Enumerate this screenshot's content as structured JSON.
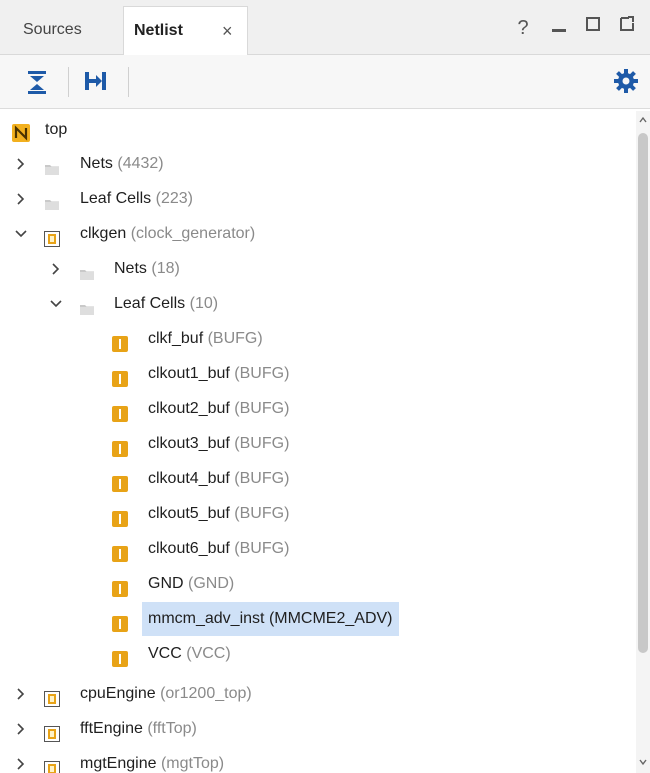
{
  "tabs": [
    {
      "label": "Sources"
    },
    {
      "label": "Netlist",
      "close": "×"
    }
  ],
  "window_controls": {
    "help": "?",
    "minimize": "_",
    "maximize": "☐",
    "float": "⧉"
  },
  "toolbar": {
    "collapse_all_icon": "collapse-all-icon",
    "expand_all_icon": "expand-all-icon",
    "settings_icon": "gear-icon"
  },
  "tree": {
    "root": {
      "name": "top",
      "icon": "N"
    },
    "rows": [
      {
        "name": "Nets",
        "meta": "(4432)"
      },
      {
        "name": "Leaf Cells",
        "meta": "(223)"
      },
      {
        "name": "clkgen",
        "meta": "(clock_generator)"
      },
      {
        "name": "Nets",
        "meta": "(18)"
      },
      {
        "name": "Leaf Cells",
        "meta": "(10)"
      },
      {
        "name": "clkf_buf",
        "meta": "(BUFG)"
      },
      {
        "name": "clkout1_buf",
        "meta": "(BUFG)"
      },
      {
        "name": "clkout2_buf",
        "meta": "(BUFG)"
      },
      {
        "name": "clkout3_buf",
        "meta": "(BUFG)"
      },
      {
        "name": "clkout4_buf",
        "meta": "(BUFG)"
      },
      {
        "name": "clkout5_buf",
        "meta": "(BUFG)"
      },
      {
        "name": "clkout6_buf",
        "meta": "(BUFG)"
      },
      {
        "name": "GND",
        "meta": "(GND)"
      },
      {
        "name": "mmcm_adv_inst",
        "meta": "(MMCME2_ADV)"
      },
      {
        "name": "VCC",
        "meta": "(VCC)"
      },
      {
        "name": "cpuEngine",
        "meta": "(or1200_top)"
      },
      {
        "name": "fftEngine",
        "meta": "(fftTop)"
      },
      {
        "name": "mgtEngine",
        "meta": "(mgtTop)"
      }
    ],
    "selected": "mmcm_adv_inst"
  },
  "colors": {
    "accent": "#1e5aa8",
    "selection": "#cfe1f7",
    "cell_icon": "#e8a317"
  }
}
